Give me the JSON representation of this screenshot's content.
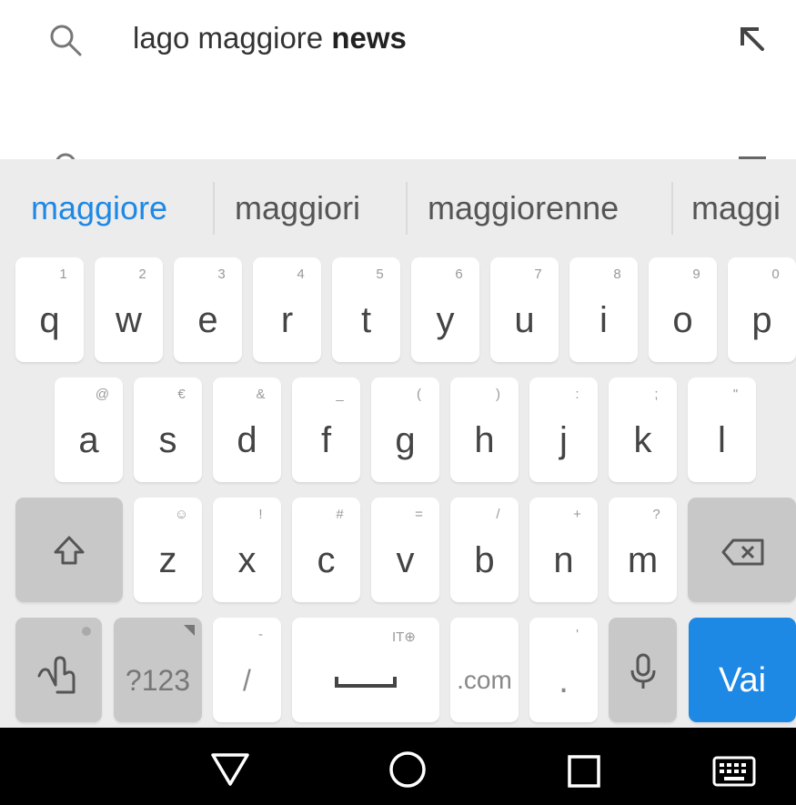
{
  "search_suggestion": {
    "prefix": "lago maggiore ",
    "bold": "news"
  },
  "candidates": [
    {
      "label": "maggiore",
      "selected": true
    },
    {
      "label": "maggiori",
      "selected": false
    },
    {
      "label": "maggiorenne",
      "selected": false
    },
    {
      "label": "maggi",
      "selected": false
    }
  ],
  "rows": {
    "row1": [
      {
        "key": "q",
        "hint": "1"
      },
      {
        "key": "w",
        "hint": "2"
      },
      {
        "key": "e",
        "hint": "3"
      },
      {
        "key": "r",
        "hint": "4"
      },
      {
        "key": "t",
        "hint": "5"
      },
      {
        "key": "y",
        "hint": "6"
      },
      {
        "key": "u",
        "hint": "7"
      },
      {
        "key": "i",
        "hint": "8"
      },
      {
        "key": "o",
        "hint": "9"
      },
      {
        "key": "p",
        "hint": "0"
      }
    ],
    "row2": [
      {
        "key": "a",
        "hint": "@"
      },
      {
        "key": "s",
        "hint": "€"
      },
      {
        "key": "d",
        "hint": "&"
      },
      {
        "key": "f",
        "hint": "_"
      },
      {
        "key": "g",
        "hint": "("
      },
      {
        "key": "h",
        "hint": ")"
      },
      {
        "key": "j",
        "hint": ":"
      },
      {
        "key": "k",
        "hint": ";"
      },
      {
        "key": "l",
        "hint": "\""
      }
    ],
    "row3": [
      {
        "key": "z",
        "hint": "☺"
      },
      {
        "key": "x",
        "hint": "!"
      },
      {
        "key": "c",
        "hint": "#"
      },
      {
        "key": "v",
        "hint": "="
      },
      {
        "key": "b",
        "hint": "/"
      },
      {
        "key": "n",
        "hint": "+"
      },
      {
        "key": "m",
        "hint": "?"
      }
    ]
  },
  "bottom_row": {
    "symbols_label": "?123",
    "slash_label": "/",
    "slash_hint": "-",
    "space_hint": "IT⊕",
    "com_label": ".com",
    "period_label": ".",
    "period_hint": "'",
    "go_label": "Vai"
  },
  "icons": {
    "search": "search-icon",
    "fill_arrow": "arrow-up-left-icon",
    "shift": "shift-icon",
    "backspace": "backspace-icon",
    "gesture": "hand-gesture-icon",
    "mic": "microphone-icon",
    "space": "space-bar-icon",
    "nav_back": "triangle-back-icon",
    "nav_home": "circle-home-icon",
    "nav_recent": "square-recent-icon",
    "nav_keyboard": "keyboard-icon"
  },
  "colors": {
    "accent": "#1e88e5",
    "keyboard_bg": "#ececec",
    "key_bg": "#ffffff",
    "key_dark": "#c8c8c8",
    "navbar": "#000000"
  }
}
